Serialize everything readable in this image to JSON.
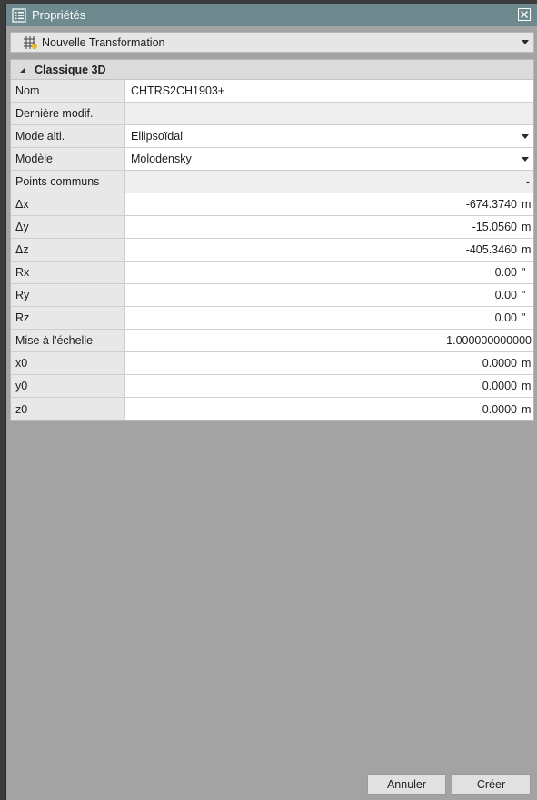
{
  "window": {
    "title": "Propriétés",
    "title_icon": "properties-list-icon",
    "close_icon": "close-icon"
  },
  "selector": {
    "icon": "transformation-grid-icon",
    "value": "Nouvelle Transformation"
  },
  "section": {
    "title": "Classique 3D"
  },
  "rows": [
    {
      "label": "Nom",
      "value": "CHTRS2CH1903+"
    },
    {
      "label": "Dernière modif.",
      "value": "-"
    },
    {
      "label": "Mode alti.",
      "value": "Ellipsoïdal"
    },
    {
      "label": "Modèle",
      "value": "Molodensky"
    },
    {
      "label": "Points communs",
      "value": "-"
    },
    {
      "label": "Δx",
      "value": "-674.3740",
      "unit": "m"
    },
    {
      "label": "Δy",
      "value": "-15.0560",
      "unit": "m"
    },
    {
      "label": "Δz",
      "value": "-405.3460",
      "unit": "m"
    },
    {
      "label": "Rx",
      "value": "0.00",
      "unit": "\""
    },
    {
      "label": "Ry",
      "value": "0.00",
      "unit": "\""
    },
    {
      "label": "Rz",
      "value": "0.00",
      "unit": "\""
    },
    {
      "label": "Mise à l'échelle",
      "value": "1.000000000000"
    },
    {
      "label": "x0",
      "value": "0.0000",
      "unit": "m"
    },
    {
      "label": "y0",
      "value": "0.0000",
      "unit": "m"
    },
    {
      "label": "z0",
      "value": "0.0000",
      "unit": "m"
    }
  ],
  "buttons": {
    "cancel": "Annuler",
    "create": "Créer"
  },
  "colors": {
    "titlebar": "#6e8a8f",
    "background": "#a3a3a3"
  }
}
